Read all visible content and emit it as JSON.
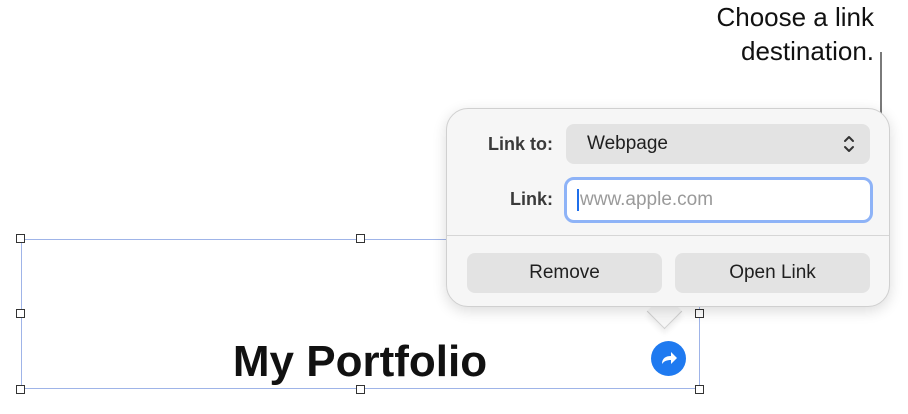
{
  "callout": {
    "line1": "Choose a link",
    "line2": "destination."
  },
  "text_box": {
    "title": "My Portfolio"
  },
  "popover": {
    "link_to_label": "Link to:",
    "link_to_value": "Webpage",
    "link_label": "Link:",
    "link_value": "",
    "link_placeholder": "www.apple.com",
    "remove_label": "Remove",
    "open_link_label": "Open Link"
  },
  "icons": {
    "select_chevrons": "up-down-chevron-icon",
    "link_badge": "curved-arrow-link-icon"
  },
  "colors": {
    "accent": "#1f7af0",
    "focus_ring": "#8eb3f7",
    "selection_border": "#9fb4e8"
  }
}
